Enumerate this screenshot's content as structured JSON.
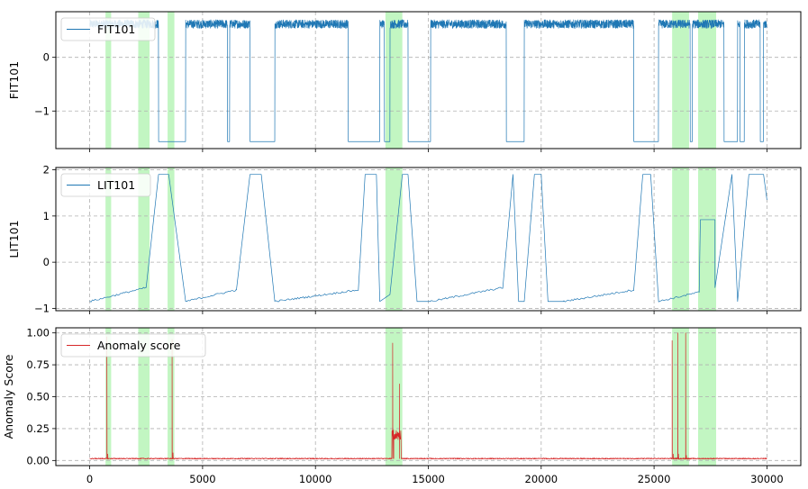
{
  "chart_data": [
    {
      "type": "line",
      "ylabel": "FIT101",
      "xlim": [
        -1500,
        31500
      ],
      "ylim": [
        -1.7,
        0.85
      ],
      "yticks": [
        0,
        -1
      ],
      "ytick_labels": [
        "0",
        "−1"
      ],
      "grid": true,
      "legend_position": "upper-left",
      "series": [
        {
          "name": "FIT101",
          "color": "#1f77b4",
          "signal": "flow",
          "on_level": 0.62,
          "off_level": -1.57,
          "noise_amplitude": 0.08,
          "on_intervals": [
            [
              0,
              3050
            ],
            [
              4250,
              6100
            ],
            [
              6200,
              7100
            ],
            [
              8200,
              11450
            ],
            [
              12850,
              13050
            ],
            [
              13300,
              14100
            ],
            [
              15100,
              18450
            ],
            [
              19250,
              21000
            ],
            [
              21000,
              24100
            ],
            [
              25200,
              26600
            ],
            [
              26700,
              28100
            ],
            [
              28700,
              28800
            ],
            [
              29000,
              29700
            ],
            [
              29850,
              30000
            ]
          ]
        }
      ],
      "highlight_intervals": [
        [
          700,
          950
        ],
        [
          2150,
          2650
        ],
        [
          3450,
          3750
        ],
        [
          13100,
          13850
        ],
        [
          25800,
          26550
        ],
        [
          26950,
          27750
        ]
      ]
    },
    {
      "type": "line",
      "ylabel": "LIT101",
      "xlim": [
        -1500,
        31500
      ],
      "ylim": [
        -1.05,
        2.05
      ],
      "yticks": [
        2,
        1,
        0,
        -1
      ],
      "ytick_labels": [
        "2",
        "1",
        "0",
        "−1"
      ],
      "grid": true,
      "legend_position": "upper-left",
      "series": [
        {
          "name": "LIT101",
          "color": "#1f77b4",
          "signal": "level",
          "x": [
            0,
            2500,
            3050,
            3500,
            4250,
            6500,
            7100,
            7600,
            8200,
            11900,
            12200,
            12700,
            12850,
            13300,
            13850,
            14100,
            14500,
            15100,
            18300,
            18750,
            19000,
            19250,
            19700,
            20000,
            20300,
            21000,
            24100,
            24500,
            24850,
            25200,
            27000,
            27050,
            27700,
            27700,
            28450,
            28700,
            29200,
            29850,
            30000
          ],
          "y": [
            -0.85,
            -0.55,
            1.9,
            1.9,
            -0.85,
            -0.6,
            1.9,
            1.9,
            -0.85,
            -0.6,
            1.9,
            1.9,
            -0.85,
            -0.7,
            1.9,
            1.9,
            -0.85,
            -0.85,
            -0.55,
            1.9,
            -0.85,
            -0.85,
            1.9,
            1.9,
            -0.85,
            -0.85,
            -0.6,
            1.9,
            1.9,
            -0.85,
            -0.65,
            0.92,
            0.92,
            -0.55,
            1.9,
            -0.85,
            1.9,
            1.9,
            1.35
          ]
        }
      ],
      "highlight_intervals": [
        [
          700,
          950
        ],
        [
          2150,
          2650
        ],
        [
          3450,
          3750
        ],
        [
          13100,
          13850
        ],
        [
          25800,
          26550
        ],
        [
          26950,
          27750
        ]
      ]
    },
    {
      "type": "line",
      "ylabel": "Anomaly Score",
      "xlim": [
        -1500,
        31500
      ],
      "ylim": [
        -0.04,
        1.04
      ],
      "yticks": [
        1.0,
        0.75,
        0.5,
        0.25,
        0.0
      ],
      "ytick_labels": [
        "1.00",
        "0.75",
        "0.50",
        "0.25",
        "0.00"
      ],
      "xticks": [
        0,
        5000,
        10000,
        15000,
        20000,
        25000,
        30000
      ],
      "xtick_labels": [
        "0",
        "5000",
        "10000",
        "15000",
        "20000",
        "25000",
        "30000"
      ],
      "grid": true,
      "legend_position": "upper-left",
      "series": [
        {
          "name": "Anomaly score",
          "color": "#d62728",
          "signal": "score",
          "baseline": 0.015,
          "spikes": [
            [
              760,
              0.97
            ],
            [
              800,
              0.05
            ],
            [
              3650,
              0.95
            ],
            [
              3690,
              0.06
            ],
            [
              13420,
              0.92
            ],
            [
              13460,
              0.2
            ],
            [
              13720,
              0.6
            ],
            [
              25800,
              0.94
            ],
            [
              25850,
              0.05
            ],
            [
              26050,
              1.0
            ],
            [
              26080,
              0.05
            ],
            [
              26400,
              1.0
            ],
            [
              26430,
              0.04
            ]
          ]
        }
      ],
      "highlight_intervals": [
        [
          700,
          950
        ],
        [
          2150,
          2650
        ],
        [
          3450,
          3750
        ],
        [
          13100,
          13850
        ],
        [
          25800,
          26550
        ],
        [
          26950,
          27750
        ]
      ]
    }
  ]
}
